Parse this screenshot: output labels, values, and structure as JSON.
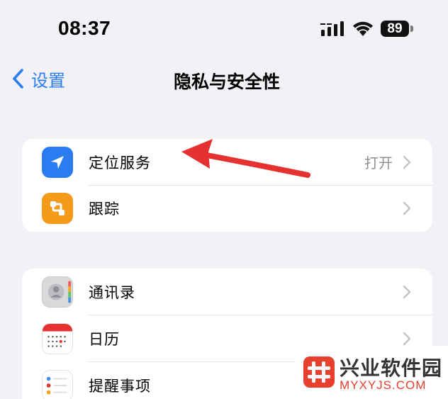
{
  "status_bar": {
    "time": "08:37",
    "battery": "89",
    "icons": [
      "cellular-signal-icon",
      "wifi-icon",
      "battery-icon"
    ]
  },
  "nav": {
    "back_label": "设置",
    "title": "隐私与安全性"
  },
  "groups": [
    {
      "items": [
        {
          "label": "定位服务",
          "value": "打开",
          "icon": "location-arrow-icon",
          "icon_color": "#2b7cf0"
        },
        {
          "label": "跟踪",
          "value": "",
          "icon": "tracking-icon",
          "icon_color": "#f59a1b"
        }
      ]
    },
    {
      "items": [
        {
          "label": "通讯录",
          "icon": "contacts-icon"
        },
        {
          "label": "日历",
          "icon": "calendar-icon"
        },
        {
          "label": "提醒事项",
          "icon": "reminders-icon"
        }
      ]
    }
  ],
  "annotation": {
    "type": "red-arrow",
    "color": "#e5312f",
    "points_to": "定位服务"
  },
  "watermark": {
    "title": "兴业软件园",
    "url": "MYXYJS.COM",
    "logo_color": "#e8402f"
  },
  "colors": {
    "accent": "#2b7cf0",
    "background": "#f1f1f6",
    "secondary_text": "#8e8e93"
  }
}
